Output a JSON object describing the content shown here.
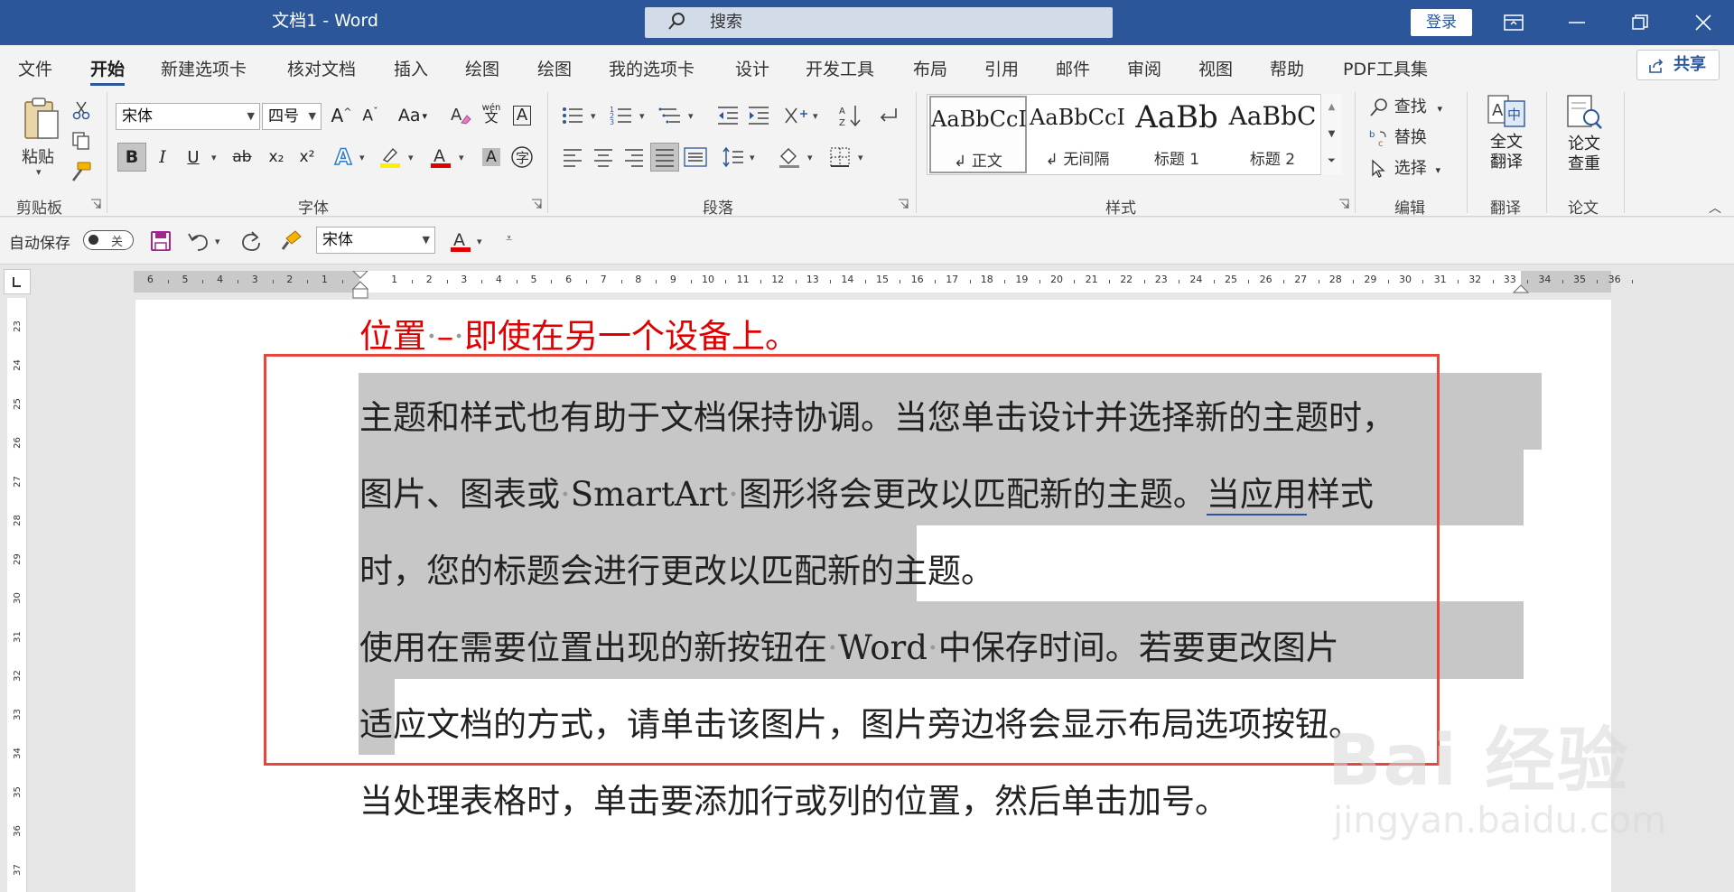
{
  "window": {
    "title": "文档1  -  Word",
    "search_placeholder": "搜索",
    "login": "登录"
  },
  "tabs": [
    "文件",
    "开始",
    "新建选项卡",
    "核对文档",
    "插入",
    "绘图",
    "绘图",
    "我的选项卡",
    "设计",
    "开发工具",
    "布局",
    "引用",
    "邮件",
    "审阅",
    "视图",
    "帮助",
    "PDF工具集"
  ],
  "active_tab": "开始",
  "share": "共享",
  "ribbon": {
    "clipboard": {
      "paste": "粘贴",
      "label": "剪贴板"
    },
    "font": {
      "name": "宋体",
      "size": "四号",
      "label": "字体",
      "aa_label": "Aa",
      "wen": "wén",
      "wen_char": "文",
      "A_box": "A",
      "bold": "B",
      "italic": "I",
      "underline": "U",
      "strike": "ab",
      "sub": "x₂",
      "sup": "x²"
    },
    "paragraph": {
      "label": "段落"
    },
    "styles": {
      "label": "样式",
      "items": [
        {
          "sample": "AaBbCcI",
          "name": "↲ 正文"
        },
        {
          "sample": "AaBbCcI",
          "name": "↲ 无间隔"
        },
        {
          "sample": "AaBb",
          "name": "标题 1"
        },
        {
          "sample": "AaBbC",
          "name": "标题 2"
        }
      ]
    },
    "editing": {
      "find": "查找",
      "replace": "替换",
      "select": "选择",
      "label": "编辑"
    },
    "translate": {
      "btn_line1": "全文",
      "btn_line2": "翻译",
      "label": "翻译"
    },
    "thesis": {
      "btn_line1": "论文",
      "btn_line2": "查重",
      "label": "论文"
    }
  },
  "qat": {
    "autosave": "自动保存",
    "toggle": "关",
    "font": "宋体"
  },
  "ruler": {
    "h_numbers": [
      "6",
      "5",
      "4",
      "3",
      "2",
      "1",
      "1",
      "2",
      "3",
      "4",
      "5",
      "6",
      "7",
      "8",
      "9",
      "10",
      "11",
      "12",
      "13",
      "14",
      "15",
      "16",
      "17",
      "18",
      "19",
      "20",
      "21",
      "22",
      "23",
      "24",
      "25",
      "26",
      "27",
      "28",
      "29",
      "30",
      "31",
      "32",
      "33",
      "34",
      "35",
      "36"
    ],
    "v_numbers": [
      "23",
      "24",
      "25",
      "26",
      "27",
      "28",
      "29",
      "30",
      "31",
      "32",
      "33",
      "34",
      "35",
      "36",
      "37"
    ]
  },
  "document": {
    "line0": {
      "a": "位置",
      "b": "–",
      "c": "即使在另一个设备上。"
    },
    "line1": "主题和样式也有助于文档保持协调。当您单击设计并选择新的主题时，",
    "line2": {
      "a": "图片、图表或",
      "b": "SmartArt",
      "c": "图形将会更改以匹配新的主题。",
      "d": "当应用",
      "e": "样式"
    },
    "line3": "时，您的标题会进行更改以匹配新的主题。",
    "line4": {
      "a": "使用在需要位置出现的新按钮在",
      "b": "Word",
      "c": "中保存时间。若要更改图片"
    },
    "line5": "适应文档的方式，请单击该图片，图片旁边将会显示布局选项按钮。",
    "line6": "当处理表格时，单击要添加行或列的位置，然后单击加号。"
  },
  "watermark": {
    "brand": "Bai 经验",
    "url": "jingyan.baidu.com"
  }
}
